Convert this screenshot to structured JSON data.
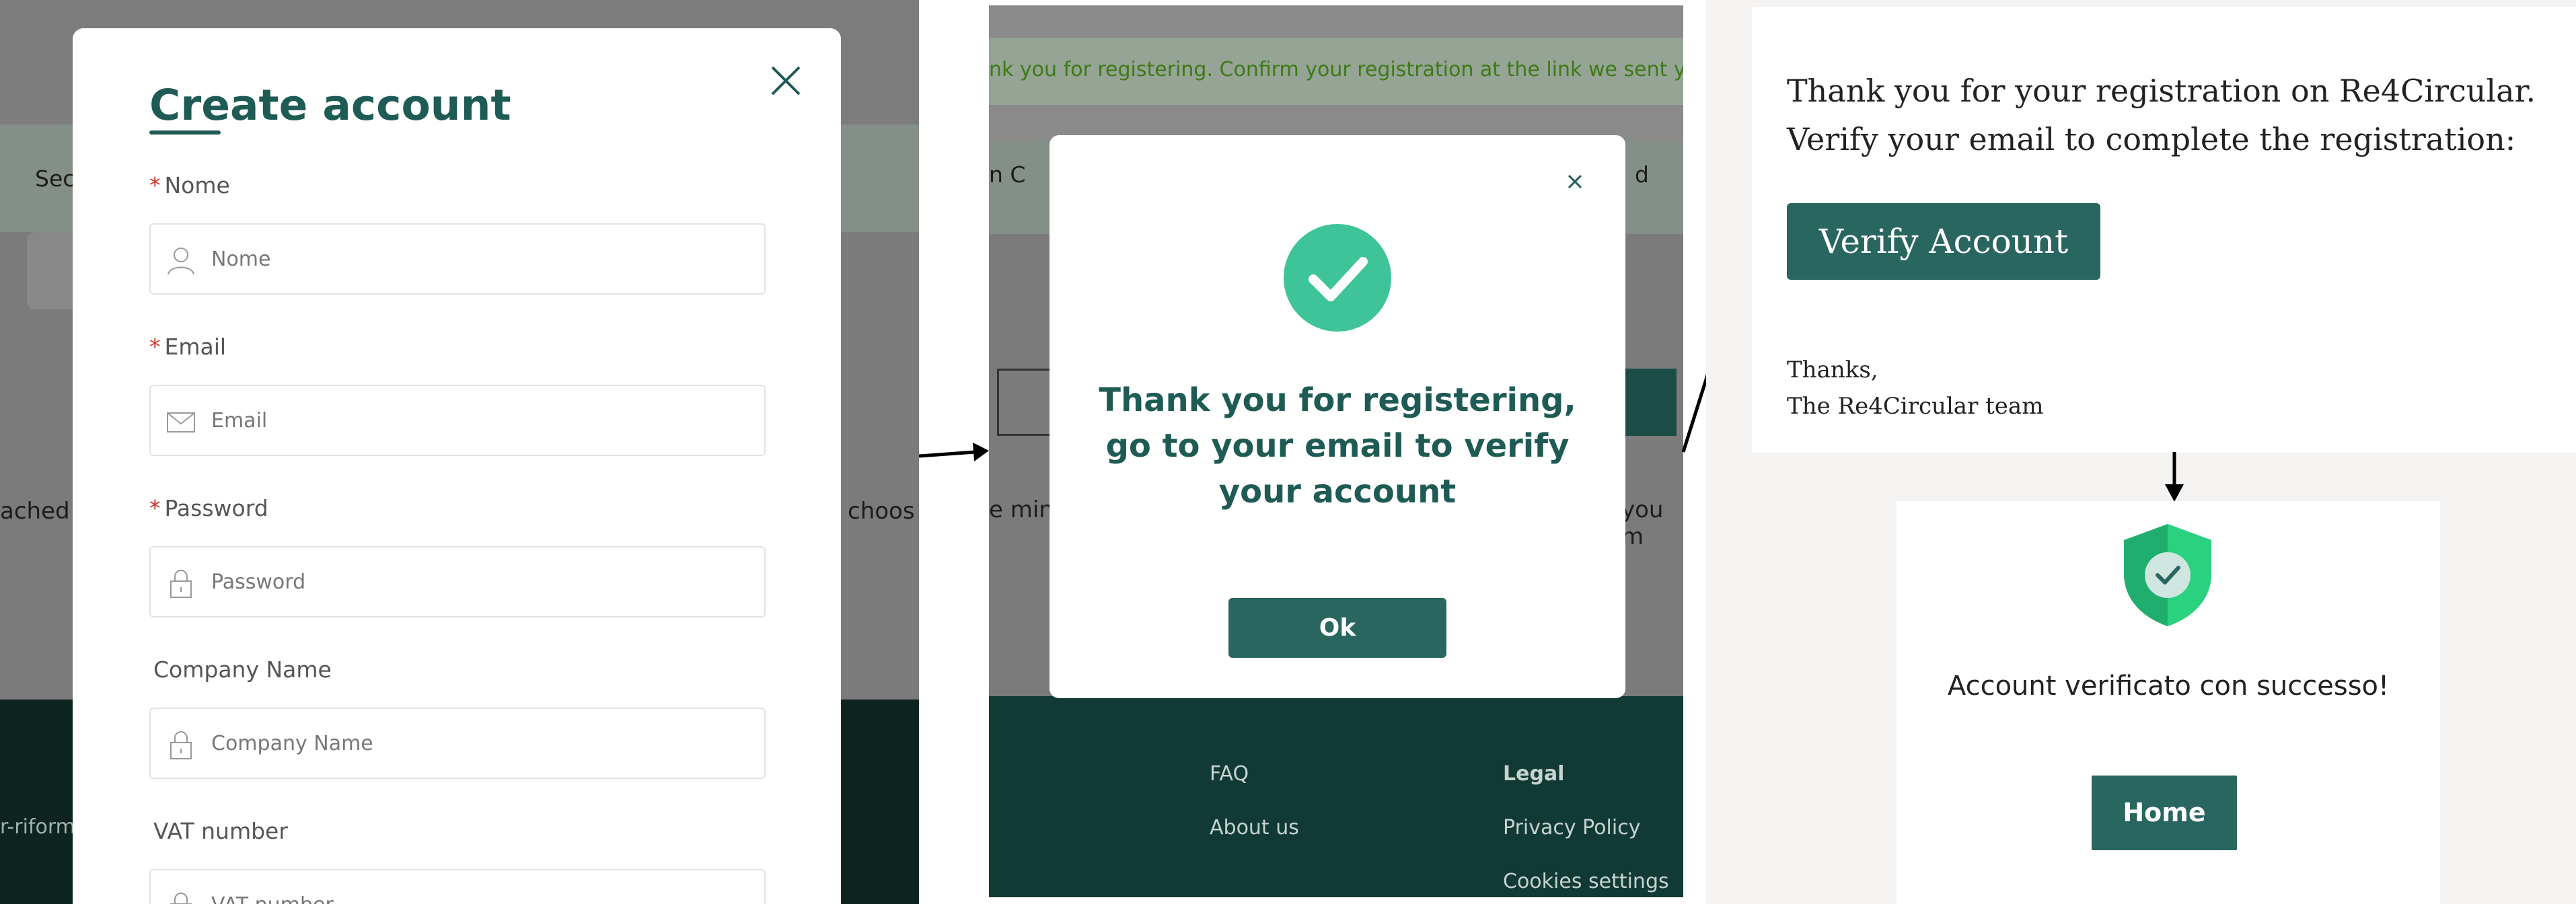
{
  "panel1": {
    "bg": {
      "nav_text": "Sec",
      "mid_text_left": "ached",
      "mid_text_right": "choos",
      "footer_text": "r-riform"
    },
    "title": "Create account",
    "fields": [
      {
        "label": "Nome",
        "required": "*",
        "placeholder": "Nome",
        "icon": "user-icon"
      },
      {
        "label": "Email",
        "required": "*",
        "placeholder": "Email",
        "icon": "mail-icon"
      },
      {
        "label": "Password",
        "required": "*",
        "placeholder": "Password",
        "icon": "lock-icon"
      },
      {
        "label": "Company Name",
        "required": "",
        "placeholder": "Company Name",
        "icon": "lock-icon"
      },
      {
        "label": "VAT number",
        "required": "",
        "placeholder": "VAT number",
        "icon": "lock-icon"
      }
    ]
  },
  "panel2": {
    "banner": "nk you for registering. Confirm your registration at the link we sent you b",
    "bg": {
      "nav_left": "n   C",
      "nav_right": "d",
      "mid_left": "e mini",
      "mid_right": "you m"
    },
    "message": "Thank you for registering, go to your email to verify your account",
    "ok_label": "Ok",
    "footer": {
      "faq": "FAQ",
      "about": "About us",
      "legal": "Legal",
      "privacy": "Privacy Policy",
      "cookies": "Cookies settings"
    }
  },
  "panel3": {
    "email": {
      "line1": "Thank you for your registration on Re4Circular.",
      "line2": "Verify your email to complete the registration:",
      "verify_label": "Verify Account",
      "thanks": "Thanks,",
      "team": "The Re4Circular team"
    },
    "verified": {
      "message": "Account verificato con successo!",
      "home_label": "Home"
    }
  },
  "colors": {
    "brand": "#2a6660",
    "brand_dark": "#123a34",
    "success": "#3fc49a",
    "required": "#d0342c"
  }
}
